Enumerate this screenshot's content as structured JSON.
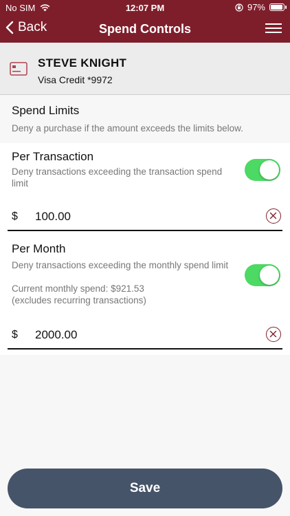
{
  "status_bar": {
    "carrier": "No SIM",
    "time": "12:07 PM",
    "battery": "97%"
  },
  "nav": {
    "back_label": "Back",
    "title": "Spend Controls"
  },
  "card": {
    "holder": "STEVE KNIGHT",
    "description": "Visa Credit *9972"
  },
  "spend_limits": {
    "title": "Spend Limits",
    "description": "Deny a purchase if the amount exceeds the limits below."
  },
  "per_transaction": {
    "title": "Per Transaction",
    "description": "Deny transactions exceeding the transaction spend limit",
    "enabled": true,
    "currency": "$",
    "amount": "100.00"
  },
  "per_month": {
    "title": "Per Month",
    "description": "Deny transactions exceeding the monthly spend limit",
    "current_spend": "Current monthly spend: $921.53",
    "note": "(excludes recurring transactions)",
    "enabled": true,
    "currency": "$",
    "amount": "2000.00"
  },
  "footer": {
    "save_label": "Save"
  },
  "colors": {
    "brand": "#7f1e2b",
    "toggle_on": "#4cd964",
    "save_button": "#455469"
  }
}
